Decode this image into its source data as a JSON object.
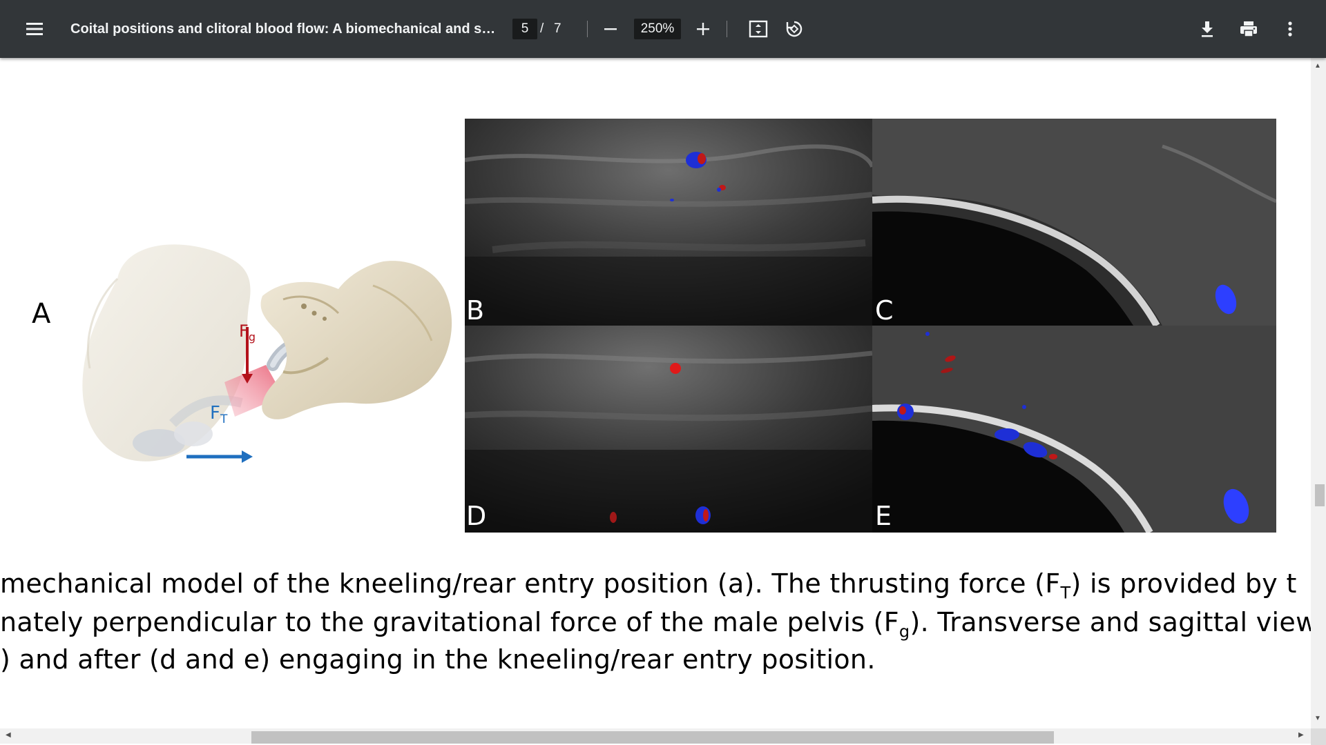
{
  "toolbar": {
    "title": "Coital positions and clitoral blood flow: A biomechanical and so...",
    "page_current": "5",
    "page_separator": "/",
    "page_total": "7",
    "zoom": "250%",
    "icons": [
      "menu-icon",
      "zoom-out-icon",
      "zoom-in-icon",
      "fit-page-icon",
      "rotate-icon",
      "download-icon",
      "print-icon",
      "more-vert-icon"
    ]
  },
  "figure": {
    "label_a": "A",
    "force_gravity_symbol": "F",
    "force_gravity_sub": "g",
    "force_thrust_symbol": "F",
    "force_thrust_sub": "T",
    "panels": [
      {
        "label": "B"
      },
      {
        "label": "C"
      },
      {
        "label": "D"
      },
      {
        "label": "E"
      }
    ],
    "colors": {
      "gravity_force": "#b3121b",
      "thrust_force": "#1f6fbf",
      "doppler_blue": "#1e2fd6",
      "doppler_red": "#c01818"
    }
  },
  "caption": {
    "line1_a": "mechanical model of the kneeling/rear entry position (a). The thrusting force (F",
    "line1_sub": "T",
    "line1_b": ") is provided by t",
    "line2_a": "nately perpendicular to the gravitational force of the male pelvis (F",
    "line2_sub": "g",
    "line2_b": "). Transverse and sagittal view",
    "line3": ") and after (d and e) engaging in the kneeling/rear entry position."
  }
}
